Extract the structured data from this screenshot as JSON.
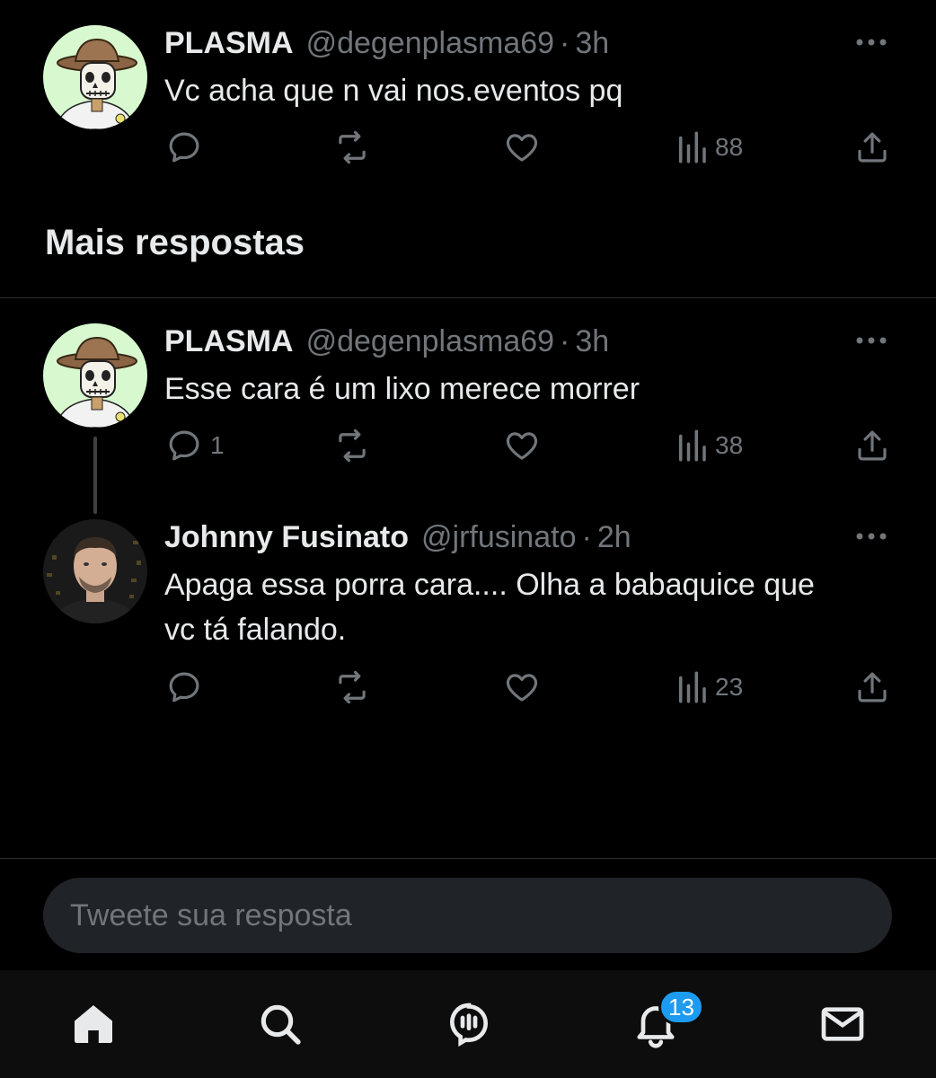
{
  "tweets": [
    {
      "name": "PLASMA",
      "handle": "@degenplasma69",
      "separator": "·",
      "time": "3h",
      "text": "Vc acha que n vai nos.eventos pq",
      "replies": "",
      "views": "88",
      "avatar_bg": "#d8f9d0"
    },
    {
      "name": "PLASMA",
      "handle": "@degenplasma69",
      "separator": "·",
      "time": "3h",
      "text": "Esse cara é um lixo merece morrer",
      "replies": "1",
      "views": "38",
      "avatar_bg": "#d8f9d0"
    },
    {
      "name": "Johnny Fusinato",
      "handle": "@jrfusinato",
      "separator": "·",
      "time": "2h",
      "text": "Apaga essa porra cara.... Olha a babaquice que vc tá falando.",
      "replies": "",
      "views": "23",
      "avatar_bg": "#1a1a1a"
    }
  ],
  "section": {
    "title": "Mais respostas"
  },
  "reply": {
    "placeholder": "Tweete sua resposta"
  },
  "nav": {
    "items": [
      "home-icon",
      "search-icon",
      "spaces-icon",
      "notifications-icon",
      "messages-icon"
    ],
    "notification_count": "13"
  },
  "colors": {
    "accent": "#1d9bf0",
    "muted": "#71767b",
    "text": "#e7e9ea",
    "background": "#000000"
  }
}
